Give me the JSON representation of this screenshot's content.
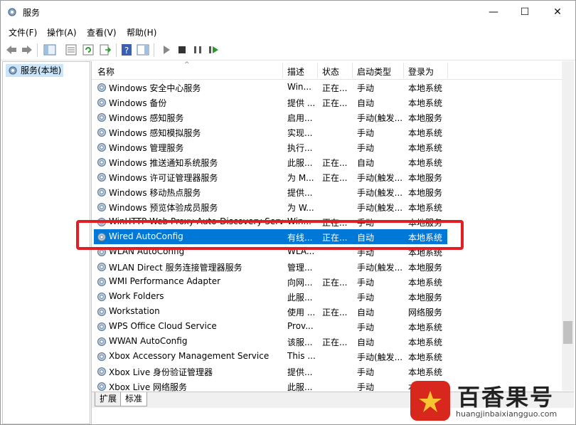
{
  "window": {
    "title": "服务",
    "minimize": "—",
    "maximize": "☐",
    "close": "✕"
  },
  "menu": [
    "文件(F)",
    "操作(A)",
    "查看(V)",
    "帮助(H)"
  ],
  "tree": {
    "label": "服务(本地)"
  },
  "columns": {
    "name": "名称",
    "desc": "描述",
    "status": "状态",
    "startup": "启动类型",
    "logon": "登录为"
  },
  "rows": [
    {
      "name": "Windows 安全中心服务",
      "desc": "Win...",
      "status": "正在...",
      "startup": "手动",
      "logon": "本地系统"
    },
    {
      "name": "Windows 备份",
      "desc": "提供 ...",
      "status": "正在...",
      "startup": "自动",
      "logon": "本地系统"
    },
    {
      "name": "Windows 感知服务",
      "desc": "启用...",
      "status": "",
      "startup": "手动(触发...",
      "logon": "本地服务"
    },
    {
      "name": "Windows 感知模拟服务",
      "desc": "实现...",
      "status": "",
      "startup": "手动",
      "logon": "本地系统"
    },
    {
      "name": "Windows 管理服务",
      "desc": "执行...",
      "status": "",
      "startup": "手动",
      "logon": "本地系统"
    },
    {
      "name": "Windows 推送通知系统服务",
      "desc": "此服...",
      "status": "正在...",
      "startup": "自动",
      "logon": "本地系统"
    },
    {
      "name": "Windows 许可证管理器服务",
      "desc": "为 M...",
      "status": "正在...",
      "startup": "手动(触发...",
      "logon": "本地服务"
    },
    {
      "name": "Windows 移动热点服务",
      "desc": "提供...",
      "status": "",
      "startup": "手动(触发...",
      "logon": "本地服务"
    },
    {
      "name": "Windows 预览体验成员服务",
      "desc": "为 W...",
      "status": "",
      "startup": "手动(触发...",
      "logon": "本地系统"
    },
    {
      "name": "WinHTTP Web Proxy Auto-Discovery Service",
      "desc": "Win...",
      "status": "正在...",
      "startup": "手动",
      "logon": "本地服务"
    },
    {
      "name": "Wired AutoConfig",
      "desc": "有线...",
      "status": "正在...",
      "startup": "自动",
      "logon": "本地系统"
    },
    {
      "name": "WLAN AutoConfig",
      "desc": "WLA...",
      "status": "",
      "startup": "手动",
      "logon": "本地系统"
    },
    {
      "name": "WLAN Direct 服务连接管理器服务",
      "desc": "管理...",
      "status": "",
      "startup": "手动(触发...",
      "logon": "本地服务"
    },
    {
      "name": "WMI Performance Adapter",
      "desc": "向网...",
      "status": "正在...",
      "startup": "手动",
      "logon": "本地系统"
    },
    {
      "name": "Work Folders",
      "desc": "此服...",
      "status": "",
      "startup": "手动",
      "logon": "本地服务"
    },
    {
      "name": "Workstation",
      "desc": "使用 ...",
      "status": "正在...",
      "startup": "自动",
      "logon": "网络服务"
    },
    {
      "name": "WPS Office Cloud Service",
      "desc": "Prov...",
      "status": "",
      "startup": "手动",
      "logon": "本地系统"
    },
    {
      "name": "WWAN AutoConfig",
      "desc": "该服...",
      "status": "正在...",
      "startup": "自动",
      "logon": "本地系统"
    },
    {
      "name": "Xbox Accessory Management Service",
      "desc": "This ...",
      "status": "",
      "startup": "手动(触发...",
      "logon": "本地系统"
    },
    {
      "name": "Xbox Live 身份验证管理器",
      "desc": "提供...",
      "status": "",
      "startup": "手动",
      "logon": "本地系统"
    },
    {
      "name": "Xbox Live 网络服务",
      "desc": "此服...",
      "status": "",
      "startup": "手动",
      "logon": "本地系统"
    }
  ],
  "selected_index": 10,
  "tabs": [
    "扩展",
    "标准"
  ],
  "watermark": {
    "title": "百香果号",
    "url": "huangjinbaixiangguo.com"
  },
  "colors": {
    "selection": "#0078d7",
    "highlight_box": "#e01e24"
  }
}
